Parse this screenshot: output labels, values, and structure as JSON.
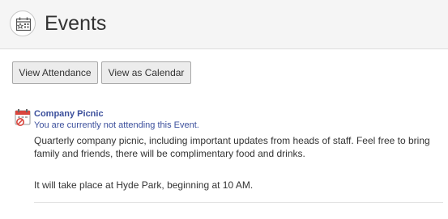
{
  "header": {
    "title": "Events",
    "icon": "calendar-star-icon",
    "background": "#f5f5f5"
  },
  "toolbar": {
    "view_attendance_label": "View Attendance",
    "view_calendar_label": "View as Calendar"
  },
  "event": {
    "icon": "calendar-event-icon",
    "title": "Company Picnic",
    "status": "You are currently not attending this Event.",
    "description": "Quarterly company picnic, including important updates from heads of staff. Feel free to bring family and friends, there will be complimentary food and drinks.",
    "location_line": "It will take place at Hyde Park, beginning at 10 AM."
  },
  "colors": {
    "link": "#3b4f9c",
    "text": "#333333",
    "calendar_red": "#d9453d"
  }
}
